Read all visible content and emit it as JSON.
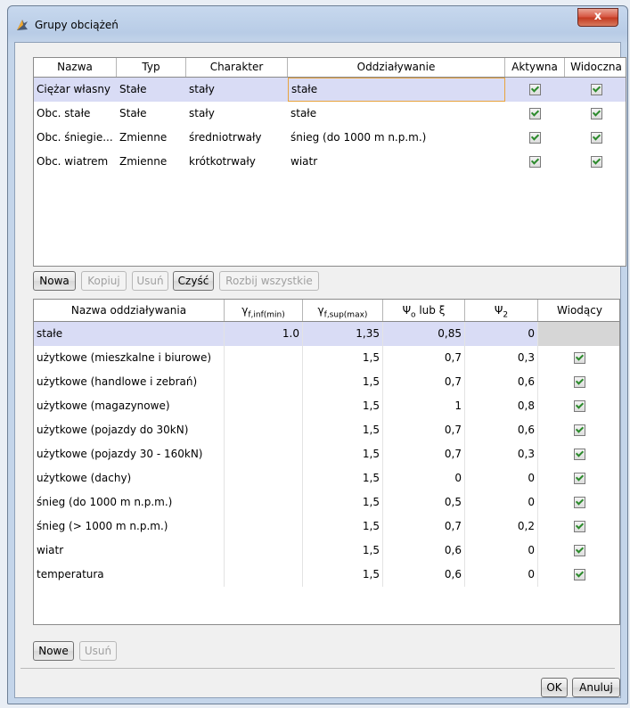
{
  "window": {
    "title": "Grupy obciążeń",
    "close_label": "x"
  },
  "groups_table": {
    "columns": [
      "Nazwa",
      "Typ",
      "Charakter",
      "Oddziaływanie",
      "Aktywna",
      "Widoczna"
    ],
    "rows": [
      {
        "nazwa": "Ciężar własny",
        "typ": "Stałe",
        "charakter": "stały",
        "oddzialywanie": "stałe",
        "aktywna": true,
        "widoczna": true,
        "selected": true
      },
      {
        "nazwa": "Obc. stałe",
        "typ": "Stałe",
        "charakter": "stały",
        "oddzialywanie": "stałe",
        "aktywna": true,
        "widoczna": true
      },
      {
        "nazwa": "Obc. śniegie...",
        "typ": "Zmienne",
        "charakter": "średniotrwały",
        "oddzialywanie": "śnieg (do 1000 m n.p.m.)",
        "aktywna": true,
        "widoczna": true
      },
      {
        "nazwa": "Obc. wiatrem",
        "typ": "Zmienne",
        "charakter": "krótkotrwały",
        "oddzialywanie": "wiatr",
        "aktywna": true,
        "widoczna": true
      }
    ]
  },
  "groups_buttons": {
    "nowa": "Nowa",
    "kopiuj": "Kopiuj",
    "usun": "Usuń",
    "czysc": "Czyść",
    "rozbij": "Rozbij wszystkie"
  },
  "actions_table": {
    "col_name": "Nazwa oddziaływania",
    "col_gmin": "γ",
    "col_gmin_sub": "f,inf(min)",
    "col_gmax": "γ",
    "col_gmax_sub": "f,sup(max)",
    "col_psi0": "Ψ",
    "col_psi0_sub": "o",
    "col_psi0_suffix": " lub ξ",
    "col_psi2": "Ψ",
    "col_psi2_sub": "2",
    "col_lead": "Wiodący",
    "rows": [
      {
        "name": "stałe",
        "gmin": "1.0",
        "gmax": "1,35",
        "psi0": "0,85",
        "psi2": "0",
        "lead": null,
        "selected": true
      },
      {
        "name": "użytkowe (mieszkalne i biurowe)",
        "gmin": "",
        "gmax": "1,5",
        "psi0": "0,7",
        "psi2": "0,3",
        "lead": true
      },
      {
        "name": "użytkowe (handlowe i zebrań)",
        "gmin": "",
        "gmax": "1,5",
        "psi0": "0,7",
        "psi2": "0,6",
        "lead": true
      },
      {
        "name": "użytkowe (magazynowe)",
        "gmin": "",
        "gmax": "1,5",
        "psi0": "1",
        "psi2": "0,8",
        "lead": true
      },
      {
        "name": "użytkowe (pojazdy do 30kN)",
        "gmin": "",
        "gmax": "1,5",
        "psi0": "0,7",
        "psi2": "0,6",
        "lead": true
      },
      {
        "name": "użytkowe (pojazdy 30 - 160kN)",
        "gmin": "",
        "gmax": "1,5",
        "psi0": "0,7",
        "psi2": "0,3",
        "lead": true
      },
      {
        "name": "użytkowe (dachy)",
        "gmin": "",
        "gmax": "1,5",
        "psi0": "0",
        "psi2": "0",
        "lead": true
      },
      {
        "name": "śnieg (do 1000 m n.p.m.)",
        "gmin": "",
        "gmax": "1,5",
        "psi0": "0,5",
        "psi2": "0",
        "lead": true
      },
      {
        "name": "śnieg (> 1000 m n.p.m.)",
        "gmin": "",
        "gmax": "1,5",
        "psi0": "0,7",
        "psi2": "0,2",
        "lead": true
      },
      {
        "name": "wiatr",
        "gmin": "",
        "gmax": "1,5",
        "psi0": "0,6",
        "psi2": "0",
        "lead": true
      },
      {
        "name": "temperatura",
        "gmin": "",
        "gmax": "1,5",
        "psi0": "0,6",
        "psi2": "0",
        "lead": true
      }
    ]
  },
  "actions_buttons": {
    "nowe": "Nowe",
    "usun": "Usuń"
  },
  "dialog_buttons": {
    "ok": "OK",
    "anuluj": "Anuluj"
  },
  "colors": {
    "selection": "#d9dcf5",
    "check": "#2c8a2c",
    "titlebar": "#b8cce6"
  }
}
